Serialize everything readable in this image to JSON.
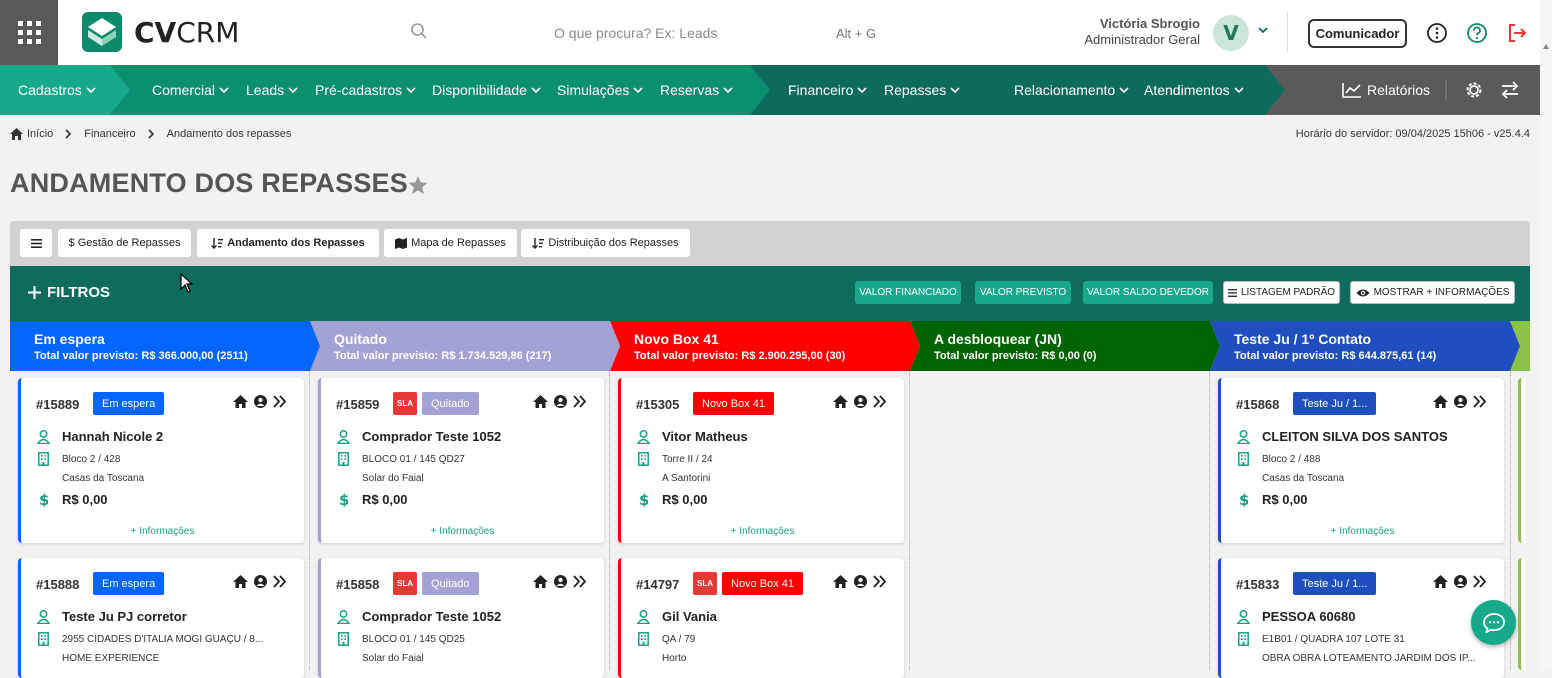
{
  "header": {
    "logo_text_bold": "CV",
    "logo_text_light": "CRM",
    "search_placeholder": "O que procura? Ex: Leads",
    "shortcut": "Alt + G",
    "user_name": "Victória Sbrogio",
    "user_role": "Administrador Geral",
    "avatar_letter": "V",
    "comunicador_label": "Comunicador"
  },
  "nav": {
    "items": [
      {
        "label": "Cadastros"
      },
      {
        "label": "Comercial"
      },
      {
        "label": "Leads"
      },
      {
        "label": "Pré-cadastros"
      },
      {
        "label": "Disponibilidade"
      },
      {
        "label": "Simulações"
      },
      {
        "label": "Reservas"
      },
      {
        "label": "Financeiro"
      },
      {
        "label": "Repasses"
      },
      {
        "label": "Relacionamento"
      },
      {
        "label": "Atendimentos"
      }
    ],
    "reports_label": "Relatórios"
  },
  "breadcrumb": {
    "home": "Início",
    "section": "Financeiro",
    "current": "Andamento dos repasses"
  },
  "server_time": "Horário do servidor: 09/04/2025 15h06 - v25.4.4",
  "page_title": "ANDAMENTO DOS REPASSES",
  "tabs": [
    {
      "label": "$ Gestão de Repasses"
    },
    {
      "label": "Andamento dos Repasses"
    },
    {
      "label": "Mapa de Repasses"
    },
    {
      "label": "Distribuição dos Repasses"
    }
  ],
  "filters": {
    "label": "FILTROS",
    "btn_financiado": "VALOR FINANCIADO",
    "btn_previsto": "VALOR PREVISTO",
    "btn_saldo": "VALOR SALDO DEVEDOR",
    "btn_listagem": "LISTAGEM PADRÃO",
    "btn_mostrar": "MOSTRAR + INFORMAÇÕES"
  },
  "columns": [
    {
      "title": "Em espera",
      "subtitle": "Total valor previsto: R$ 366.000,00 (2511)",
      "color": "#0066ff"
    },
    {
      "title": "Quitado",
      "subtitle": "Total valor previsto: R$ 1.734.529,86 (217)",
      "color": "#a2a2d4"
    },
    {
      "title": "Novo Box 41",
      "subtitle": "Total valor previsto: R$ 2.900.295,00 (30)",
      "color": "#ff0000"
    },
    {
      "title": "A desbloquear (JN)",
      "subtitle": "Total valor previsto: R$ 0,00 (0)",
      "color": "#006400"
    },
    {
      "title": "Teste Ju / 1º Contato",
      "subtitle": "Total valor previsto: R$ 644.875,61 (14)",
      "color": "#1f4fbf"
    }
  ],
  "cards": [
    {
      "id": "#15889",
      "badge": "Em espera",
      "name": "Hannah Nicole 2",
      "unit": "Bloco 2 / 428",
      "project": "Casas da Toscana",
      "value": "R$ 0,00",
      "more": "+ Informações"
    },
    {
      "id": "#15859",
      "sla": "SLA",
      "badge": "Quitado",
      "name": "Comprador Teste 1052",
      "unit": "BLOCO 01 / 145 QD27",
      "project": "Solar do Faial",
      "value": "R$ 0,00",
      "more": "+ Informações"
    },
    {
      "id": "#15305",
      "badge": "Novo Box 41",
      "name": "Vitor Matheus",
      "unit": "Torre II / 24",
      "project": "A Santorini",
      "value": "R$ 0,00",
      "more": "+ Informações"
    },
    {
      "id": "#15868",
      "badge": "Teste Ju / 1...",
      "name": "CLEITON SILVA DOS SANTOS",
      "unit": "Bloco 2 / 488",
      "project": "Casas da Toscana",
      "value": "R$ 0,00",
      "more": "+ Informações"
    },
    {
      "id": "#15888",
      "badge": "Em espera",
      "name": "Teste Ju PJ corretor",
      "unit": "2955 CIDADES D'ITALIA MOGI GUAÇU / 8...",
      "project": "HOME EXPERIENCE"
    },
    {
      "id": "#15858",
      "sla": "SLA",
      "badge": "Quitado",
      "name": "Comprador Teste 1052",
      "unit": "BLOCO 01 / 145 QD25",
      "project": "Solar do Faial"
    },
    {
      "id": "#14797",
      "sla": "SLA",
      "badge": "Novo Box 41",
      "name": "Gil Vania",
      "unit": "QA / 79",
      "project": "Horto"
    },
    {
      "id": "#15833",
      "badge": "Teste Ju / 1...",
      "name": "PESSOA 60680",
      "unit": "E1B01 / QUADRA 107 LOTE 31",
      "project": "OBRA OBRA LOTEAMENTO JARDIM DOS IP..."
    }
  ]
}
